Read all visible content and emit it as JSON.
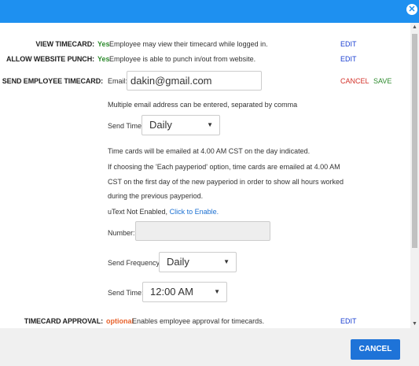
{
  "header": {
    "close_icon": "close-circle-icon"
  },
  "rows": {
    "view_timecard": {
      "label": "VIEW TIMECARD:",
      "status": "Yes",
      "description": "Employee may view their timecard while logged in.",
      "action": "EDIT"
    },
    "allow_website_punch": {
      "label": "ALLOW WEBSITE PUNCH:",
      "status": "Yes",
      "description": "Employee is able to punch in/out from website.",
      "action": "EDIT"
    },
    "send_employee_timecard": {
      "label": "SEND EMPLOYEE TIMECARD:",
      "email_label": "Email:",
      "email_value": "dakin@gmail.com",
      "cancel": "CANCEL",
      "save": "SAVE",
      "email_hint": "Multiple email address can be entered, separated by comma",
      "send_time_label": "Send Time:",
      "send_time_value": "Daily",
      "info_lines": [
        "Time cards will be emailed at 4.00 AM CST on the day indicated.",
        "If choosing the 'Each payperiod' option, time cards are emailed at 4.00 AM",
        "CST on the first day of the new payperiod in order to show all hours worked",
        "during the previous payperiod."
      ],
      "utext_status": "uText Not Enabled,",
      "utext_link": "Click to Enable.",
      "number_label": "Number:",
      "number_value": "",
      "frequency_label": "Send Frequency:",
      "frequency_value": "Daily",
      "send_time2_label": "Send Time:",
      "send_time2_value": "12:00 AM"
    },
    "timecard_approval": {
      "label": "TIMECARD APPROVAL:",
      "status": "optional",
      "description": "Enables employee approval for timecards.",
      "action": "EDIT"
    }
  },
  "footer": {
    "cancel_label": "CANCEL"
  },
  "colors": {
    "header_bg": "#1E90F0",
    "link": "#1a3fd1",
    "yes": "#2e8b2e",
    "optional": "#e8632c",
    "cancel_link": "#d3322a",
    "footer_button": "#1E73D8"
  }
}
